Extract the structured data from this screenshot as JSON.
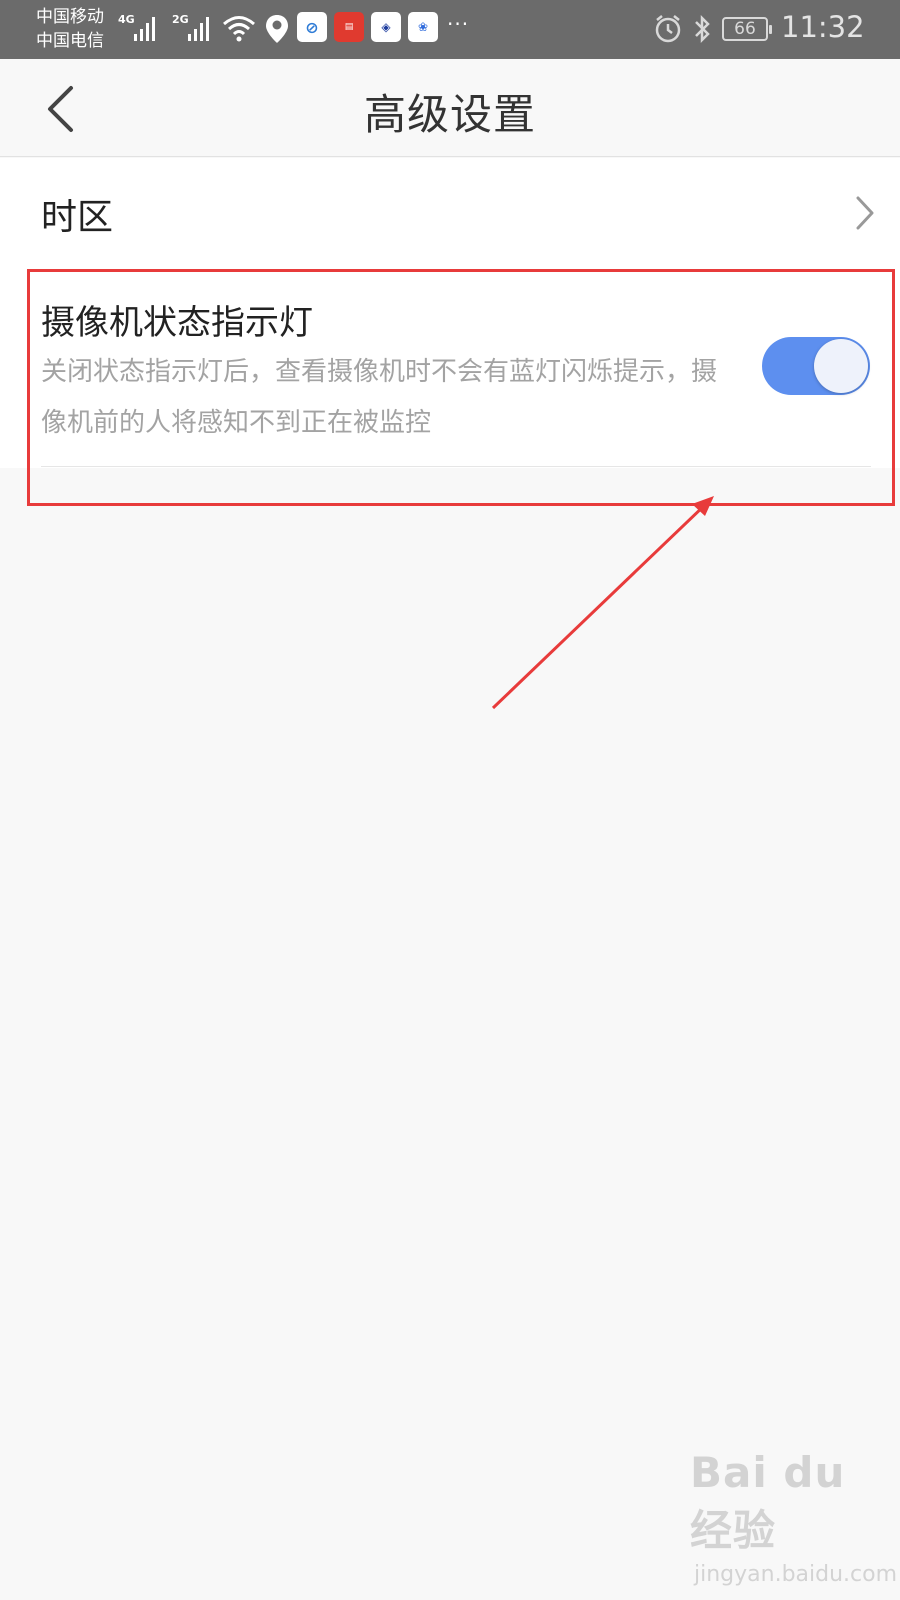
{
  "status_bar": {
    "carrier_1": "中国移动",
    "carrier_2": "中国电信",
    "net_1": "4G",
    "net_2": "2G",
    "battery": "66",
    "time": "11:32",
    "more": "···",
    "icons": [
      "signal-icon",
      "wifi-icon",
      "location-icon",
      "app-icon",
      "app-icon",
      "app-icon",
      "baidu-icon",
      "alarm-icon",
      "bluetooth-icon",
      "battery-icon"
    ],
    "colors": {
      "background": "#6b6b6b"
    }
  },
  "header": {
    "title": "高级设置",
    "back_icon": "back-chevron-icon"
  },
  "settings": {
    "timezone": {
      "label": "时区"
    },
    "indicator_light": {
      "title": "摄像机状态指示灯",
      "description": "关闭状态指示灯后，查看摄像机时不会有蓝灯闪烁提示，摄像机前的人将感知不到正在被监控",
      "enabled": true
    }
  },
  "colors": {
    "toggle_on": "#5d8fef",
    "annotation": "#e83b3b",
    "page_background": "#f8f8f8"
  },
  "watermark": {
    "logo": "Bai du 经验",
    "url": "jingyan.baidu.com"
  }
}
